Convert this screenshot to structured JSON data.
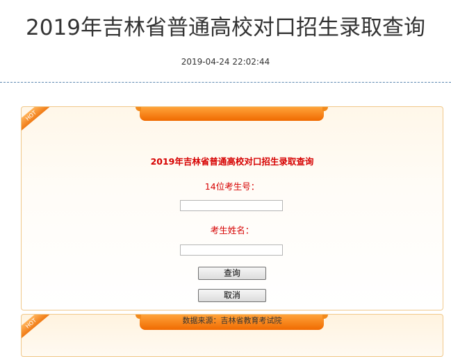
{
  "page": {
    "title": "2019年吉林省普通高校对口招生录取查询",
    "publish_time": "2019-04-24 22:02:44"
  },
  "query_panel": {
    "hot_badge": "HOT",
    "form_title": "2019年吉林省普通高校对口招生录取查询",
    "exam_number_label": "14位考生号：",
    "exam_number_value": "",
    "name_label": "考生姓名：",
    "name_value": "",
    "query_button": "查询",
    "cancel_button": "取消"
  },
  "source_panel": {
    "hot_badge": "HOT",
    "source_text": "数据来源：吉林省教育考试院"
  },
  "colors": {
    "accent_orange": "#f07a14",
    "label_red": "#d60000",
    "divider_blue": "#5b87b0"
  }
}
